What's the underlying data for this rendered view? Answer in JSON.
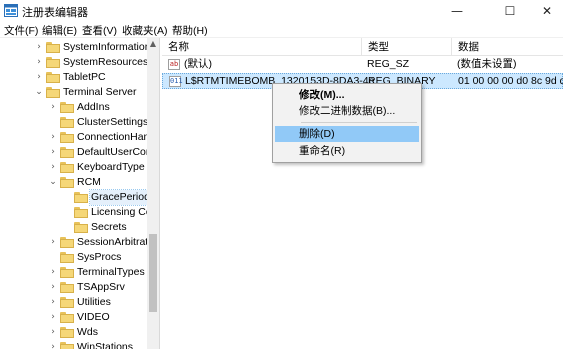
{
  "window": {
    "title": "注册表编辑器",
    "minimize_glyph": "—",
    "maximize_glyph": "☐",
    "close_glyph": "✕",
    "icon": "regedit-icon"
  },
  "menubar": {
    "items": [
      {
        "label": "文件(F)"
      },
      {
        "label": "编辑(E)"
      },
      {
        "label": "查看(V)"
      },
      {
        "label": "收藏夹(A)"
      },
      {
        "label": "帮助(H)"
      }
    ]
  },
  "tree": {
    "items": [
      {
        "label": "SystemInformation",
        "expander": "›"
      },
      {
        "label": "SystemResources",
        "expander": "›"
      },
      {
        "label": "TabletPC",
        "expander": "›"
      },
      {
        "label": "Terminal Server",
        "expander": "⌄"
      },
      {
        "label": "AddIns",
        "expander": "›"
      },
      {
        "label": "ClusterSettings",
        "expander": ""
      },
      {
        "label": "ConnectionHand",
        "expander": "›"
      },
      {
        "label": "DefaultUserCon",
        "expander": "›"
      },
      {
        "label": "KeyboardType M",
        "expander": "›"
      },
      {
        "label": "RCM",
        "expander": "⌄"
      },
      {
        "label": "GracePeriod",
        "expander": "",
        "selected": true
      },
      {
        "label": "Licensing Co",
        "expander": ""
      },
      {
        "label": "Secrets",
        "expander": ""
      },
      {
        "label": "SessionArbitrati",
        "expander": "›"
      },
      {
        "label": "SysProcs",
        "expander": ""
      },
      {
        "label": "TerminalTypes",
        "expander": "›"
      },
      {
        "label": "TSAppSrv",
        "expander": "›"
      },
      {
        "label": "Utilities",
        "expander": "›"
      },
      {
        "label": "VIDEO",
        "expander": "›"
      },
      {
        "label": "Wds",
        "expander": "›"
      },
      {
        "label": "WinStations",
        "expander": "›"
      }
    ],
    "scroll_up_glyph": "▲"
  },
  "list": {
    "columns": [
      "名称",
      "类型",
      "数据"
    ],
    "rows": [
      {
        "icon_text": "ab",
        "name": "(默认)",
        "type": "REG_SZ",
        "data": "(数值未设置)"
      },
      {
        "icon_text": "011",
        "name": "L$RTMTIMEBOMB_1320153D-8DA3-4e...",
        "type": "REG_BINARY",
        "data": "01 00 00 00 d0 8c 9d df",
        "selected": true
      }
    ]
  },
  "context_menu": {
    "items": [
      {
        "label": "修改(M)..."
      },
      {
        "label": "修改二进制数据(B)..."
      },
      {
        "label": "删除(D)"
      },
      {
        "label": "重命名(R)"
      }
    ]
  },
  "colors": {
    "selection": "#cce8ff",
    "menu_highlight": "#91c9f7",
    "folder": "#f5d778"
  }
}
